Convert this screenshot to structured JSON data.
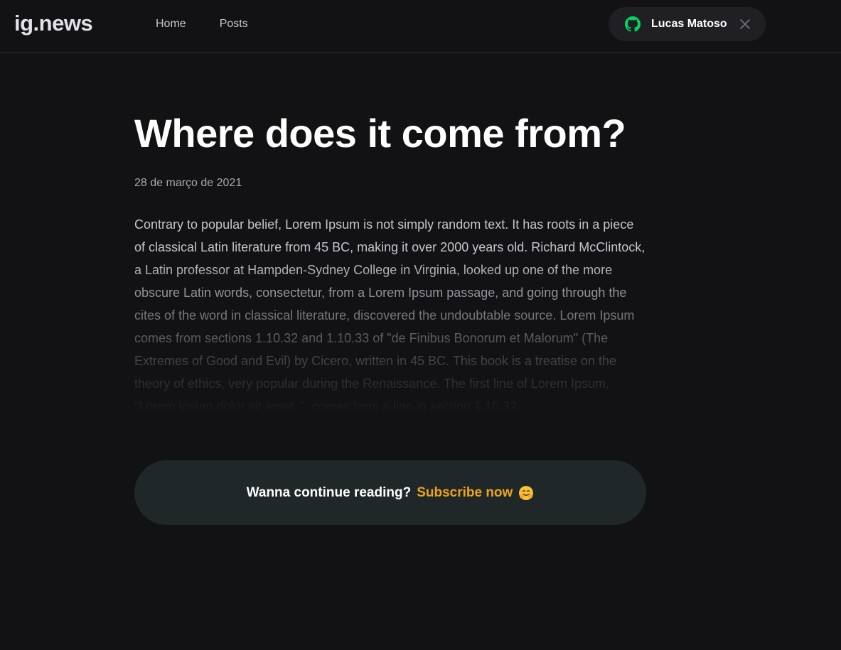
{
  "header": {
    "logo": "ig.news",
    "nav": [
      {
        "label": "Home"
      },
      {
        "label": "Posts"
      }
    ],
    "user": {
      "name": "Lucas Matoso",
      "icon": "github-icon",
      "close_icon": "close-icon"
    }
  },
  "post": {
    "title": "Where does it come from?",
    "date": "28 de março de 2021",
    "content": "Contrary to popular belief, Lorem Ipsum is not simply random text. It has roots in a piece of classical Latin literature from 45 BC, making it over 2000 years old. Richard McClintock, a Latin professor at Hampden-Sydney College in Virginia, looked up one of the more obscure Latin words, consectetur, from a Lorem Ipsum passage, and going through the cites of the word in classical literature, discovered the undoubtable source. Lorem Ipsum comes from sections 1.10.32 and 1.10.33 of \"de Finibus Bonorum et Malorum\" (The Extremes of Good and Evil) by Cicero, written in 45 BC. This book is a treatise on the theory of ethics, very popular during the Renaissance. The first line of Lorem Ipsum, \"Lorem ipsum dolor sit amet..\", comes from a line in section 1.10.32."
  },
  "subscribe": {
    "text": "Wanna continue reading?",
    "link": "Subscribe now",
    "emoji": "hugging-face-emoji"
  },
  "colors": {
    "background": "#121214",
    "accent": "#eba417",
    "github_green": "#04d361",
    "pill": "#202024",
    "subscribe_box": "#1f2729"
  }
}
